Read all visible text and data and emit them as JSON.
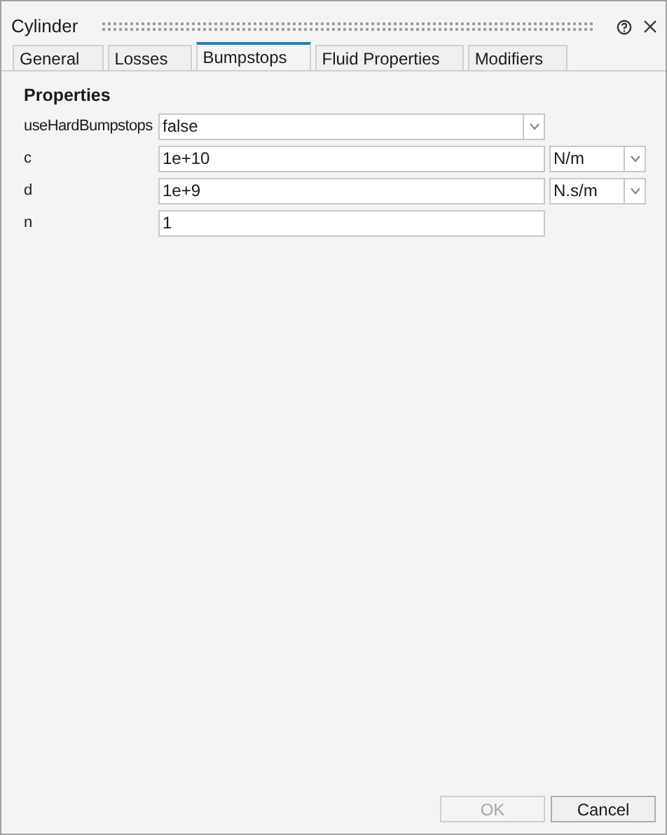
{
  "window": {
    "title": "Cylinder"
  },
  "tabs": [
    {
      "label": "General",
      "selected": false
    },
    {
      "label": "Losses",
      "selected": false
    },
    {
      "label": "Bumpstops",
      "selected": true
    },
    {
      "label": "Fluid Properties",
      "selected": false
    },
    {
      "label": "Modifiers",
      "selected": false
    }
  ],
  "section": "Properties",
  "properties": [
    {
      "kind": "dropdown",
      "label": "useHardBumpstops",
      "value": "false"
    },
    {
      "kind": "input",
      "label": "c",
      "value": "1e+10",
      "unit": "N/m"
    },
    {
      "kind": "input",
      "label": "d",
      "value": "1e+9",
      "unit": "N.s/m"
    },
    {
      "kind": "input",
      "label": "n",
      "value": "1"
    }
  ],
  "buttons": [
    {
      "label": "OK",
      "disabled": true
    },
    {
      "label": "Cancel",
      "disabled": false
    }
  ]
}
